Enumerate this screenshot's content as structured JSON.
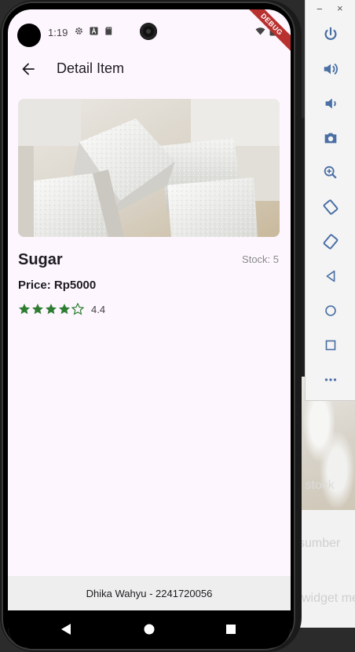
{
  "status_bar": {
    "time": "1:19",
    "icons": [
      "settings-icon",
      "a-icon",
      "sd-card-icon",
      "wifi-icon",
      "battery-icon"
    ],
    "debug_label": "DEBUG"
  },
  "app_bar": {
    "back_icon": "arrow-back-icon",
    "title": "Detail Item"
  },
  "item": {
    "image_desc_icon": "sugar-cubes-image",
    "name": "Sugar",
    "stock": "Stock: 5",
    "price": "Price: Rp5000",
    "rating": 4.4,
    "rating_label": "4.4",
    "stars_filled": 4,
    "stars_total": 5
  },
  "footer": {
    "text": "Dhika Wahyu - 2241720056"
  },
  "nav_bar": {
    "icons": [
      "back-triangle-icon",
      "home-circle-icon",
      "recents-square-icon"
    ]
  },
  "emulator_panel": {
    "minimize": "−",
    "close": "×",
    "icons": [
      "power-icon",
      "volume-up-icon",
      "volume-down-icon",
      "camera-icon",
      "zoom-icon",
      "rotate-left-icon",
      "rotate-right-icon",
      "back-icon",
      "home-icon",
      "overview-icon",
      "more-icon"
    ]
  },
  "ide_background": {
    "code_glyphs": [
      "e",
      "t"
    ],
    "snippet_1": "k stock",
    "snippet_2": "l sumber",
    "snippet_3": "widget me"
  },
  "colors": {
    "screen_bg": "#fdf6fe",
    "star": "#2e7d32",
    "debug_ribbon": "#b8312f",
    "footer_bg": "#eeeeee"
  }
}
